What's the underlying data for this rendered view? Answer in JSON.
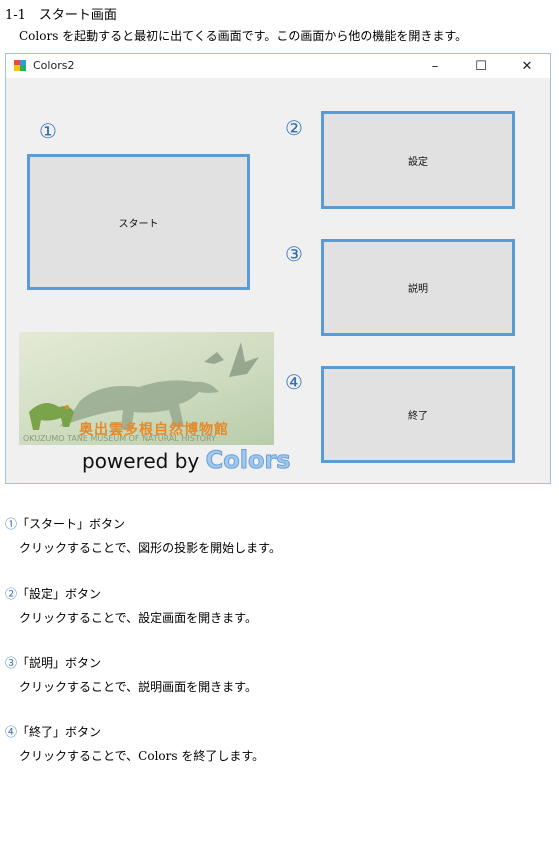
{
  "doc": {
    "heading": "1-1　スタート画面",
    "intro": "Colors を起動すると最初に出てくる画面です。この画面から他の機能を開きます。"
  },
  "window": {
    "title": "Colors2",
    "minimize": "–",
    "maximize": "☐",
    "close": "✕"
  },
  "form": {
    "start_label": "スタート",
    "settings_label": "設定",
    "help_label": "説明",
    "exit_label": "終了",
    "markers": [
      "①",
      "②",
      "③",
      "④"
    ],
    "logo": {
      "museum_ja": "奥出雲多根自然博物館",
      "museum_en": "OKUZUMO TANE MUSEUM OF NATURAL HISTORY",
      "powered_by": "powered by",
      "brand": "Colors"
    }
  },
  "items": [
    {
      "marker": "①",
      "title": "「スタート」ボタン",
      "desc": "クリックすることで、図形の投影を開始します。"
    },
    {
      "marker": "②",
      "title": "「設定」ボタン",
      "desc": "クリックすることで、設定画面を開きます。"
    },
    {
      "marker": "③",
      "title": "「説明」ボタン",
      "desc": "クリックすることで、説明画面を開きます。"
    },
    {
      "marker": "④",
      "title": "「終了」ボタン",
      "desc": "クリックすることで、Colors を終了します。"
    }
  ],
  "colors": {
    "button_border": "#5b9bd5",
    "marker_blue": "#2e6fb5",
    "window_border": "#9fc3e6"
  }
}
